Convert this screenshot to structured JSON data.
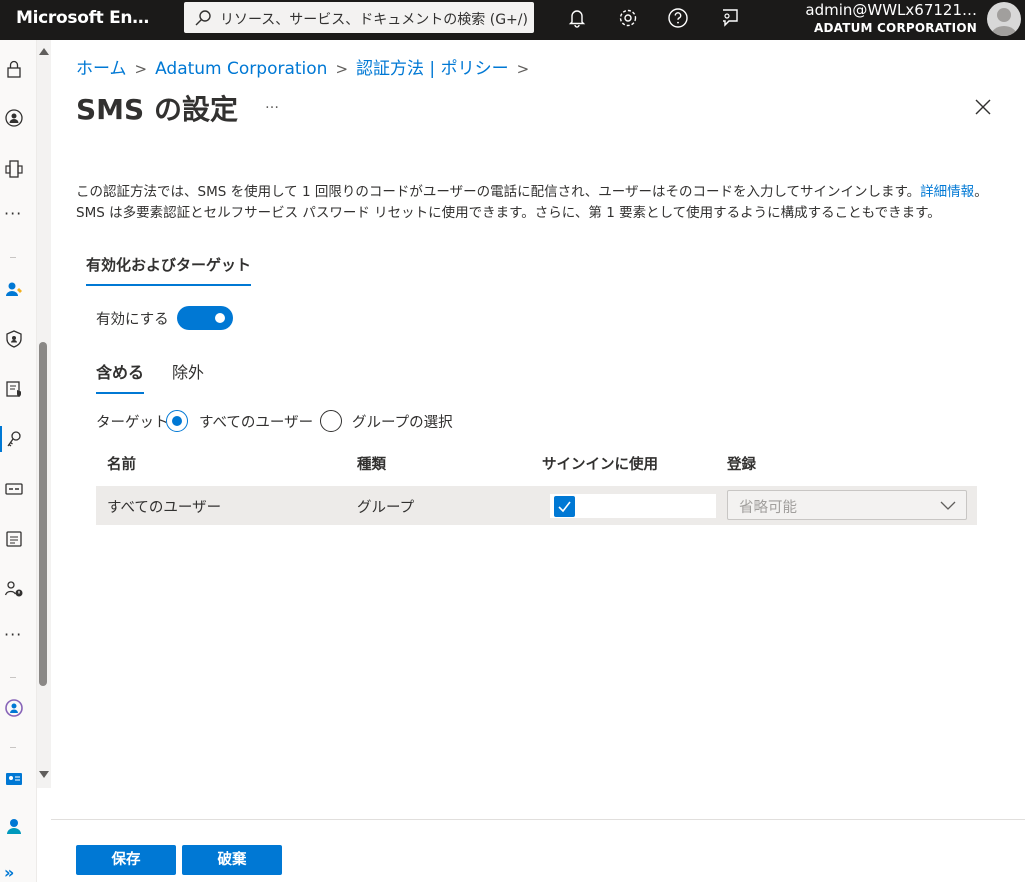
{
  "topbar": {
    "brand": "Microsoft En…",
    "search_placeholder": "リソース、サービス、ドキュメントの検索 (G+/)",
    "icons": [
      "bell-icon",
      "settings-icon",
      "help-icon",
      "feedback-icon"
    ],
    "user": "admin@WWLx67121…",
    "tenant": "ADATUM CORPORATION"
  },
  "rail": {
    "icons": [
      "lock-icon",
      "identity-icon",
      "devices-icon",
      "users-icon",
      "shield-icon",
      "policy-icon",
      "key-icon",
      "id-card-icon",
      "document-icon",
      "user-warning-icon",
      "group-admin-icon",
      "verified-id-icon",
      "learn-icon"
    ],
    "expand": "»"
  },
  "breadcrumb": {
    "items": [
      "ホーム",
      "Adatum Corporation",
      "認証方法 | ポリシー"
    ],
    "separator": ">"
  },
  "page": {
    "title": "SMS の設定",
    "more": "…",
    "description_line1": "この認証方法では、SMS を使用して 1 回限りのコードがユーザーの電話に配信され、ユーザーはそのコードを入力してサインインします。",
    "learn_more": "詳細情報",
    "description_end": "。",
    "description_line2": "SMS は多要素認証とセルフサービス パスワード リセットに使用できます。さらに、第 1 要素として使用するように構成することもできます。"
  },
  "section_tab": "有効化およびターゲット",
  "enable": {
    "label": "有効にする",
    "state": true
  },
  "tabs": {
    "include": "含める",
    "exclude": "除外"
  },
  "target": {
    "label": "ターゲット",
    "options": [
      "すべてのユーザー",
      "グループの選択"
    ],
    "selected": "すべてのユーザー"
  },
  "table": {
    "headers": [
      "名前",
      "種類",
      "サインインに使用",
      "登録"
    ],
    "rows": [
      {
        "name": "すべてのユーザー",
        "type": "グループ",
        "signin": true,
        "registration": "省略可能"
      }
    ]
  },
  "footer": {
    "save": "保存",
    "discard": "破棄"
  },
  "colors": {
    "accent": "#0078d4",
    "topbar": "#1b1a19",
    "row": "#edebe9"
  }
}
